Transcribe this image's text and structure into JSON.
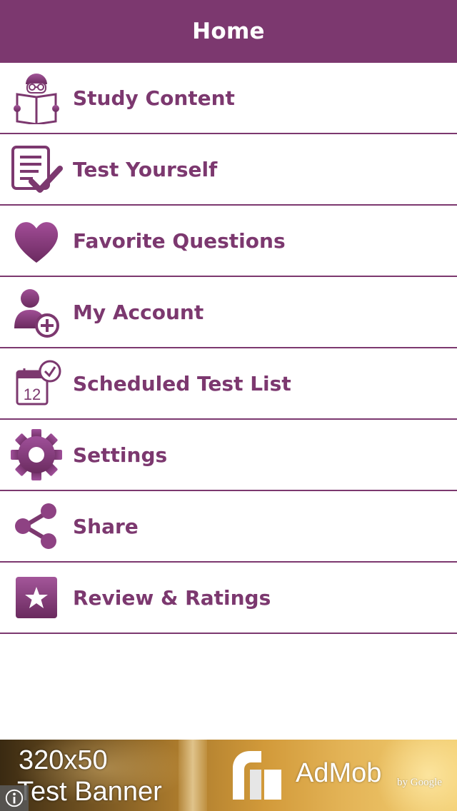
{
  "header": {
    "title": "Home"
  },
  "menu": {
    "items": [
      {
        "label": "Study Content",
        "icon": "reading-book-icon"
      },
      {
        "label": "Test Yourself",
        "icon": "checklist-icon"
      },
      {
        "label": "Favorite Questions",
        "icon": "heart-icon"
      },
      {
        "label": "My Account",
        "icon": "user-add-icon"
      },
      {
        "label": "Scheduled Test List",
        "icon": "calendar-clock-icon"
      },
      {
        "label": "Settings",
        "icon": "gear-icon"
      },
      {
        "label": "Share",
        "icon": "share-icon"
      },
      {
        "label": "Review & Ratings",
        "icon": "star-icon"
      }
    ]
  },
  "ad": {
    "size_text": "320x50",
    "banner_text": "Test Banner",
    "brand": "AdMob",
    "by_text": "by Google",
    "info_icon": "info-icon"
  },
  "colors": {
    "accent": "#7c386f",
    "background": "#ffffff",
    "header_text": "#ffffff"
  }
}
